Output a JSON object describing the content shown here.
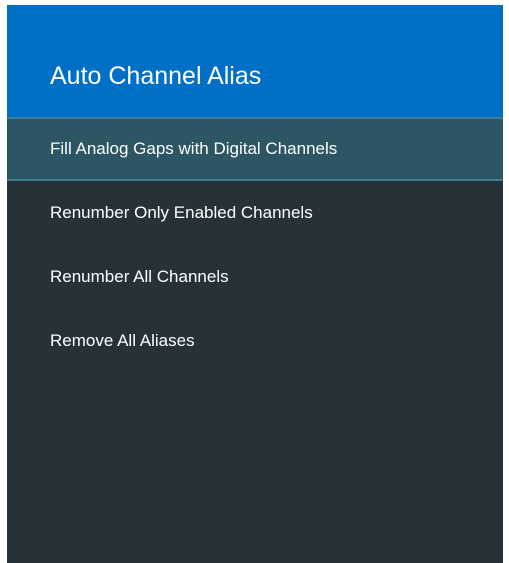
{
  "header": {
    "title": "Auto Channel Alias"
  },
  "menu": {
    "items": [
      {
        "label": "Fill Analog Gaps with Digital Channels",
        "selected": true
      },
      {
        "label": "Renumber Only Enabled Channels",
        "selected": false
      },
      {
        "label": "Renumber All Channels",
        "selected": false
      },
      {
        "label": "Remove All Aliases",
        "selected": false
      }
    ]
  },
  "colors": {
    "header_bg": "#0070c6",
    "panel_bg": "#263238",
    "selected_bg": "#2d5664",
    "text": "#ffffff"
  }
}
